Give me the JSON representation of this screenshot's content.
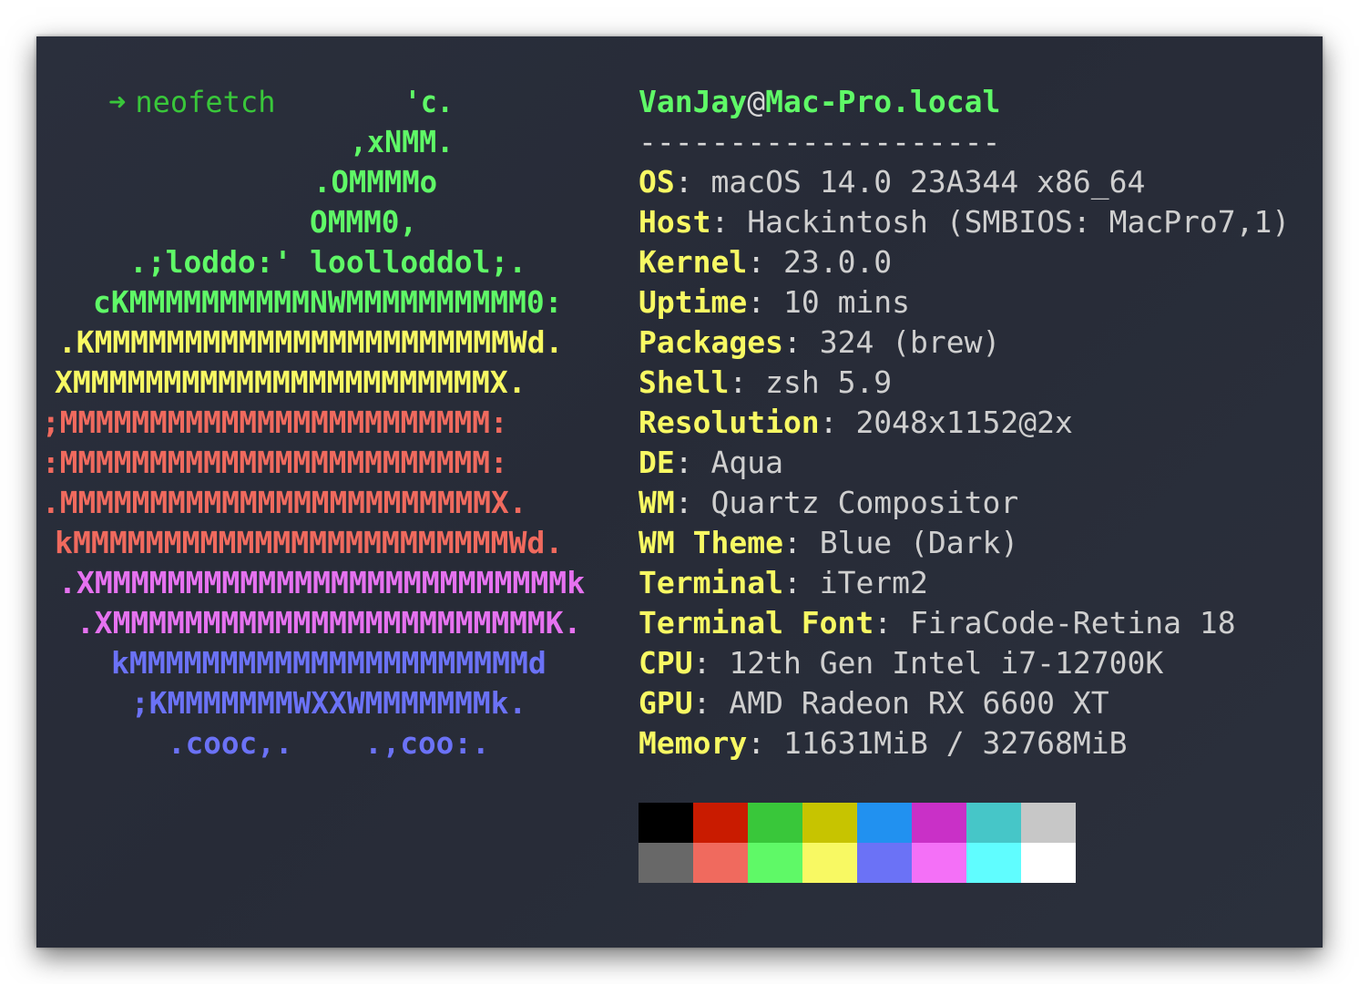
{
  "prompt": {
    "arrow": "➜",
    "command": "neofetch"
  },
  "logo": {
    "lines": [
      {
        "text": "'c.",
        "color": "#5ff967"
      },
      {
        "text": ",xNMM.",
        "color": "#5ff967"
      },
      {
        "text": ".OMMMMo",
        "color": "#5ff967"
      },
      {
        "text": "OMMM0,",
        "color": "#5ff967"
      },
      {
        "text": ".;loddo:' loolloddol;.",
        "color": "#5ff967"
      },
      {
        "text": "cKMMMMMMMMMMNWMMMMMMMMMM0:",
        "color": "#5ff967"
      },
      {
        "text": ".KMMMMMMMMMMMMMMMMMMMMMMMWd.",
        "color": "#f8f963"
      },
      {
        "text": "XMMMMMMMMMMMMMMMMMMMMMMMX.",
        "color": "#f8f963"
      },
      {
        "text": ";MMMMMMMMMMMMMMMMMMMMMMMM:",
        "color": "#f06a5e"
      },
      {
        "text": ":MMMMMMMMMMMMMMMMMMMMMMMM:",
        "color": "#f06a5e"
      },
      {
        "text": ".MMMMMMMMMMMMMMMMMMMMMMMMX.",
        "color": "#f06a5e"
      },
      {
        "text": "kMMMMMMMMMMMMMMMMMMMMMMMMWd.",
        "color": "#f06a5e"
      },
      {
        "text": ".XMMMMMMMMMMMMMMMMMMMMMMMMMMk",
        "color": "#e672f0"
      },
      {
        "text": ".XMMMMMMMMMMMMMMMMMMMMMMMMK.",
        "color": "#e672f0"
      },
      {
        "text": "kMMMMMMMMMMMMMMMMMMMMMMd",
        "color": "#6b72f6"
      },
      {
        "text": ";KMMMMMMMWXXWMMMMMMMk.",
        "color": "#6b72f6"
      },
      {
        "text": ".cooc,.    .,coo:.",
        "color": "#6b72f6"
      }
    ]
  },
  "info": {
    "user": "VanJay",
    "at": "@",
    "host": "Mac-Pro.local",
    "separator": "--------------------",
    "rows": [
      {
        "key": "OS",
        "value": "macOS 14.0 23A344 x86_64"
      },
      {
        "key": "Host",
        "value": "Hackintosh (SMBIOS: MacPro7,1)"
      },
      {
        "key": "Kernel",
        "value": "23.0.0"
      },
      {
        "key": "Uptime",
        "value": "10 mins"
      },
      {
        "key": "Packages",
        "value": "324 (brew)"
      },
      {
        "key": "Shell",
        "value": "zsh 5.9"
      },
      {
        "key": "Resolution",
        "value": "2048x1152@2x"
      },
      {
        "key": "DE",
        "value": "Aqua"
      },
      {
        "key": "WM",
        "value": "Quartz Compositor"
      },
      {
        "key": "WM Theme",
        "value": "Blue (Dark)"
      },
      {
        "key": "Terminal",
        "value": "iTerm2"
      },
      {
        "key": "Terminal Font",
        "value": "FiraCode-Retina 18"
      },
      {
        "key": "CPU",
        "value": "12th Gen Intel i7-12700K"
      },
      {
        "key": "GPU",
        "value": "AMD Radeon RX 6600 XT"
      },
      {
        "key": "Memory",
        "value": "11631MiB / 32768MiB"
      }
    ]
  },
  "palette": {
    "normal": [
      "#000000",
      "#c91b00",
      "#39c73a",
      "#c7c400",
      "#2191f0",
      "#c930c7",
      "#46c6c8",
      "#c7c7c7"
    ],
    "bright": [
      "#686868",
      "#f06a5e",
      "#5ff967",
      "#f8f963",
      "#6b72f6",
      "#f470f7",
      "#60fdff",
      "#ffffff"
    ]
  }
}
